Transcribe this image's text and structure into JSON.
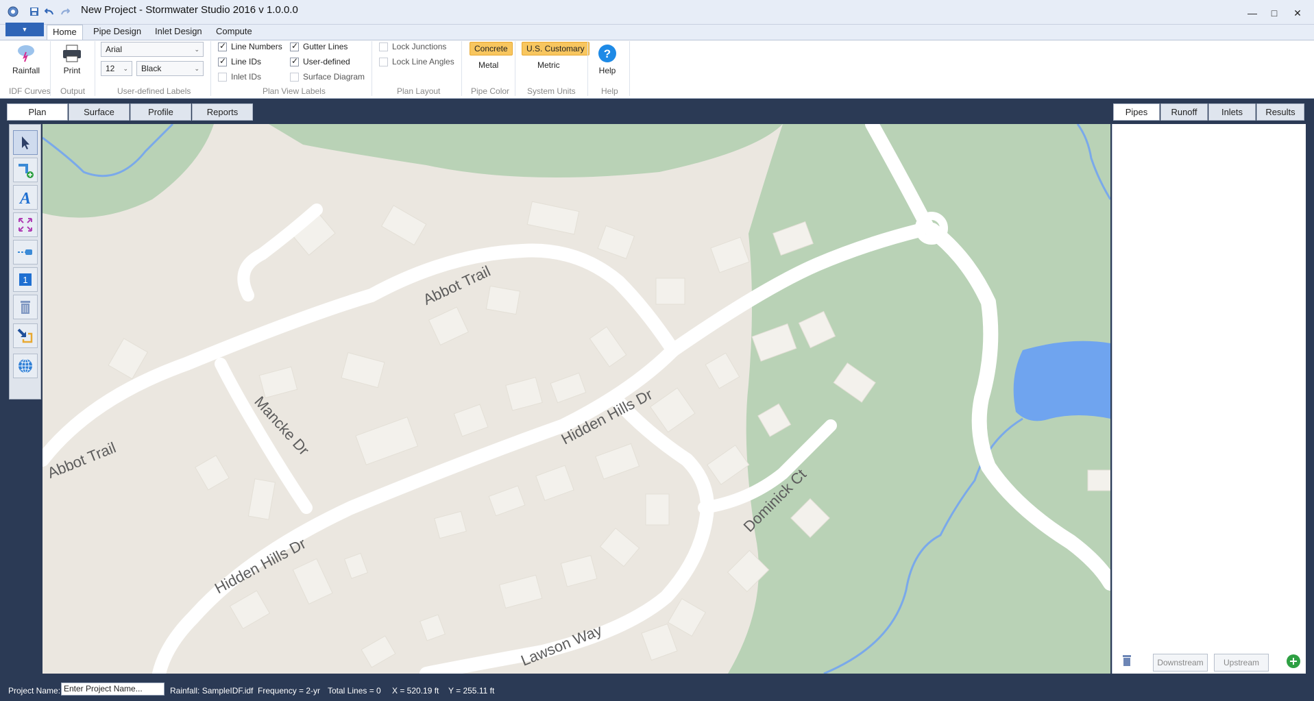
{
  "window": {
    "title": "New Project - Stormwater Studio 2016 v 1.0.0.0",
    "file_button_glyph": "▼"
  },
  "ribbon": {
    "tabs": [
      "Home",
      "Pipe Design",
      "Inlet Design",
      "Compute"
    ],
    "active_tab": "Home",
    "groups": {
      "idf_curves": {
        "label": "IDF Curves",
        "button": "Rainfall"
      },
      "output": {
        "label": "Output",
        "button": "Print"
      },
      "user_labels": {
        "label": "User-defined Labels",
        "font": "Arial",
        "size": "12",
        "color": "Black"
      },
      "plan_view_labels": {
        "label": "Plan View Labels",
        "checks": [
          {
            "label": "Line Numbers",
            "checked": true
          },
          {
            "label": "Line IDs",
            "checked": true
          },
          {
            "label": "Inlet IDs",
            "checked": false
          },
          {
            "label": "Gutter Lines",
            "checked": true
          },
          {
            "label": "User-defined",
            "checked": true
          },
          {
            "label": "Surface Diagram",
            "checked": false
          }
        ]
      },
      "plan_layout": {
        "label": "Plan Layout",
        "checks": [
          {
            "label": "Lock Junctions",
            "checked": false
          },
          {
            "label": "Lock Line Angles",
            "checked": false
          }
        ]
      },
      "pipe_color": {
        "label": "Pipe Color",
        "options": [
          "Concrete",
          "Metal"
        ],
        "selected": "Concrete"
      },
      "system_units": {
        "label": "System Units",
        "options": [
          "U.S. Customary",
          "Metric"
        ],
        "selected": "U.S. Customary"
      },
      "help": {
        "label": "Help",
        "button": "Help"
      }
    }
  },
  "view_tabs": [
    "Plan",
    "Surface",
    "Profile",
    "Reports"
  ],
  "active_view_tab": "Plan",
  "right_tabs": [
    "Pipes",
    "Runoff",
    "Inlets",
    "Results"
  ],
  "active_right_tab": "Pipes",
  "right_buttons": {
    "downstream": "Downstream",
    "upstream": "Upstream"
  },
  "toolbar": {
    "tools": [
      "select-arrow-icon",
      "add-line-icon",
      "text-icon",
      "zoom-extents-icon",
      "junction-icon",
      "number-icon",
      "delete-icon",
      "import-icon",
      "globe-icon"
    ]
  },
  "map": {
    "street_labels": [
      "Abbot Trail",
      "Abbot Trail",
      "Mancke Dr",
      "Hidden Hills Dr",
      "Hidden Hills Dr",
      "Dominick Ct",
      "Lawson Way"
    ],
    "colors": {
      "ground": "#ebe7e0",
      "green": "#b9d2b6",
      "water": "#6fa4ef",
      "road": "#ffffff",
      "building": "#f3f1ec"
    }
  },
  "status": {
    "project_name_label": "Project Name:",
    "project_name_placeholder": "Enter Project Name...",
    "rainfall": "Rainfall: SampleIDF.idf",
    "frequency": "Frequency = 2-yr",
    "total_lines": "Total Lines = 0",
    "x": "X = 520.19 ft",
    "y": "Y = 255.11 ft"
  }
}
